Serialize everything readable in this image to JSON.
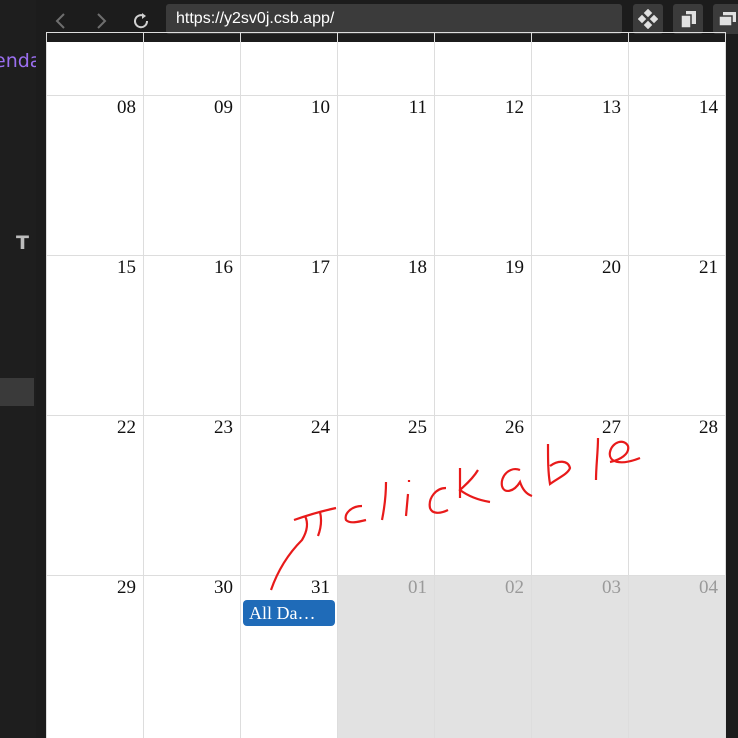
{
  "browser": {
    "url": "https://y2sv0j.csb.app/",
    "back_icon": "chevron-left-icon",
    "forward_icon": "chevron-right-icon",
    "reload_icon": "reload-icon",
    "toolbar_icons": [
      "extension-icon",
      "copy-icon",
      "windows-icon"
    ]
  },
  "sidebar": {
    "fragment_text": "enda",
    "t_letter": "T"
  },
  "calendar": {
    "weeks": [
      [
        {
          "day": "",
          "muted": false
        },
        {
          "day": "",
          "muted": false
        },
        {
          "day": "",
          "muted": false
        },
        {
          "day": "",
          "muted": false
        },
        {
          "day": "",
          "muted": false
        },
        {
          "day": "",
          "muted": false
        },
        {
          "day": "",
          "muted": false
        }
      ],
      [
        {
          "day": "08",
          "muted": false
        },
        {
          "day": "09",
          "muted": false
        },
        {
          "day": "10",
          "muted": false
        },
        {
          "day": "11",
          "muted": false
        },
        {
          "day": "12",
          "muted": false
        },
        {
          "day": "13",
          "muted": false
        },
        {
          "day": "14",
          "muted": false
        }
      ],
      [
        {
          "day": "15",
          "muted": false
        },
        {
          "day": "16",
          "muted": false
        },
        {
          "day": "17",
          "muted": false
        },
        {
          "day": "18",
          "muted": false
        },
        {
          "day": "19",
          "muted": false
        },
        {
          "day": "20",
          "muted": false
        },
        {
          "day": "21",
          "muted": false
        }
      ],
      [
        {
          "day": "22",
          "muted": false
        },
        {
          "day": "23",
          "muted": false
        },
        {
          "day": "24",
          "muted": false
        },
        {
          "day": "25",
          "muted": false
        },
        {
          "day": "26",
          "muted": false
        },
        {
          "day": "27",
          "muted": false
        },
        {
          "day": "28",
          "muted": false
        }
      ],
      [
        {
          "day": "29",
          "muted": false
        },
        {
          "day": "30",
          "muted": false
        },
        {
          "day": "31",
          "muted": false
        },
        {
          "day": "01",
          "muted": true
        },
        {
          "day": "02",
          "muted": true
        },
        {
          "day": "03",
          "muted": true
        },
        {
          "day": "04",
          "muted": true
        }
      ]
    ],
    "event": {
      "label": "All Da…",
      "color": "#1f6bb8"
    }
  },
  "annotation": {
    "text": "clickable",
    "color": "#e02020"
  },
  "colors": {
    "grid_line": "#dddddd",
    "muted_bg": "#e2e2e2",
    "topbar": "#1c1c1c"
  }
}
